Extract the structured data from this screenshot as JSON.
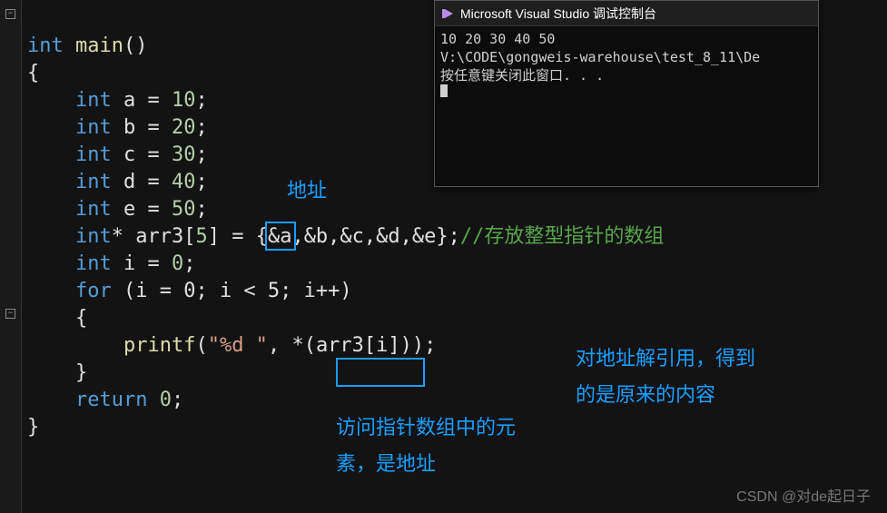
{
  "code": {
    "main_kw": "int",
    "main_fn": "main",
    "brace_open": "{",
    "brace_close": "}",
    "decl_a_kw": "int",
    "decl_a_name": "a",
    "decl_a_val": "10",
    "decl_b_kw": "int",
    "decl_b_name": "b",
    "decl_b_val": "20",
    "decl_c_kw": "int",
    "decl_c_name": "c",
    "decl_c_val": "30",
    "decl_d_kw": "int",
    "decl_d_name": "d",
    "decl_d_val": "40",
    "decl_e_kw": "int",
    "decl_e_name": "e",
    "decl_e_val": "50",
    "arr_kw": "int",
    "arr_ptr": "*",
    "arr_name": "arr3",
    "arr_size": "5",
    "arr_init": "&a,&b,&c,&d,&e",
    "arr_init_hl": "&a",
    "arr_init_rest": ",&b,&c,&d,&e",
    "arr_cmt": "//存放整型指针的数组",
    "decl_i_kw": "int",
    "decl_i_name": "i",
    "decl_i_val": "0",
    "for_kw": "for",
    "for_cond": "(i = 0; i < 5; i++)",
    "printf_name": "printf",
    "printf_fmt": "\"%d \"",
    "printf_arg_star": "*",
    "printf_arg_open": "(",
    "printf_arg_arr": "arr3",
    "printf_arg_lbr": "[",
    "printf_arg_idx": "i",
    "printf_arg_rbr": "]",
    "printf_arg_close": ")",
    "return_kw": "return",
    "return_val": "0"
  },
  "notes": {
    "addr": "地址",
    "deref1": "对地址解引用，得到",
    "deref2": "的是原来的内容",
    "access1": "访问指针数组中的元",
    "access2": "素，是地址"
  },
  "console": {
    "title": "Microsoft Visual Studio 调试控制台",
    "line1": "10 20 30 40 50",
    "line2": "V:\\CODE\\gongweis-warehouse\\test_8_11\\De",
    "line3": "按任意键关闭此窗口. . ."
  },
  "watermark": "CSDN @对de起日子"
}
